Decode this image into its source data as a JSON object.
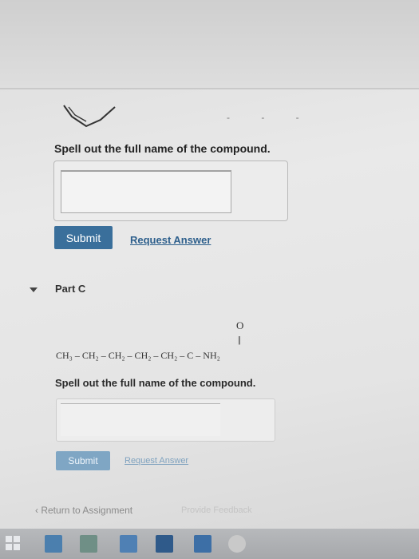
{
  "part_b": {
    "prompt": "Spell out the full name of the compound.",
    "answer_value": "",
    "submit_label": "Submit",
    "request_answer_label": "Request Answer"
  },
  "part_c": {
    "label": "Part C",
    "formula": {
      "top_atom": "O",
      "double_bond": "||",
      "chain": "CH₃ – CH₂ – CH₂ – CH₂ – CH₂ – C – NH₂"
    },
    "prompt": "Spell out the full name of the compound.",
    "answer_value": "",
    "submit_label": "Submit",
    "request_answer_label": "Request Answer"
  },
  "footer": {
    "return_label": "Return to Assignment",
    "feedback_label": "Provide Feedback"
  },
  "icons": {
    "caret": "caret-down-icon",
    "return": "chevron-left-icon"
  },
  "colors": {
    "submit_bg": "#3a6f9b",
    "link": "#2d5f8c"
  }
}
